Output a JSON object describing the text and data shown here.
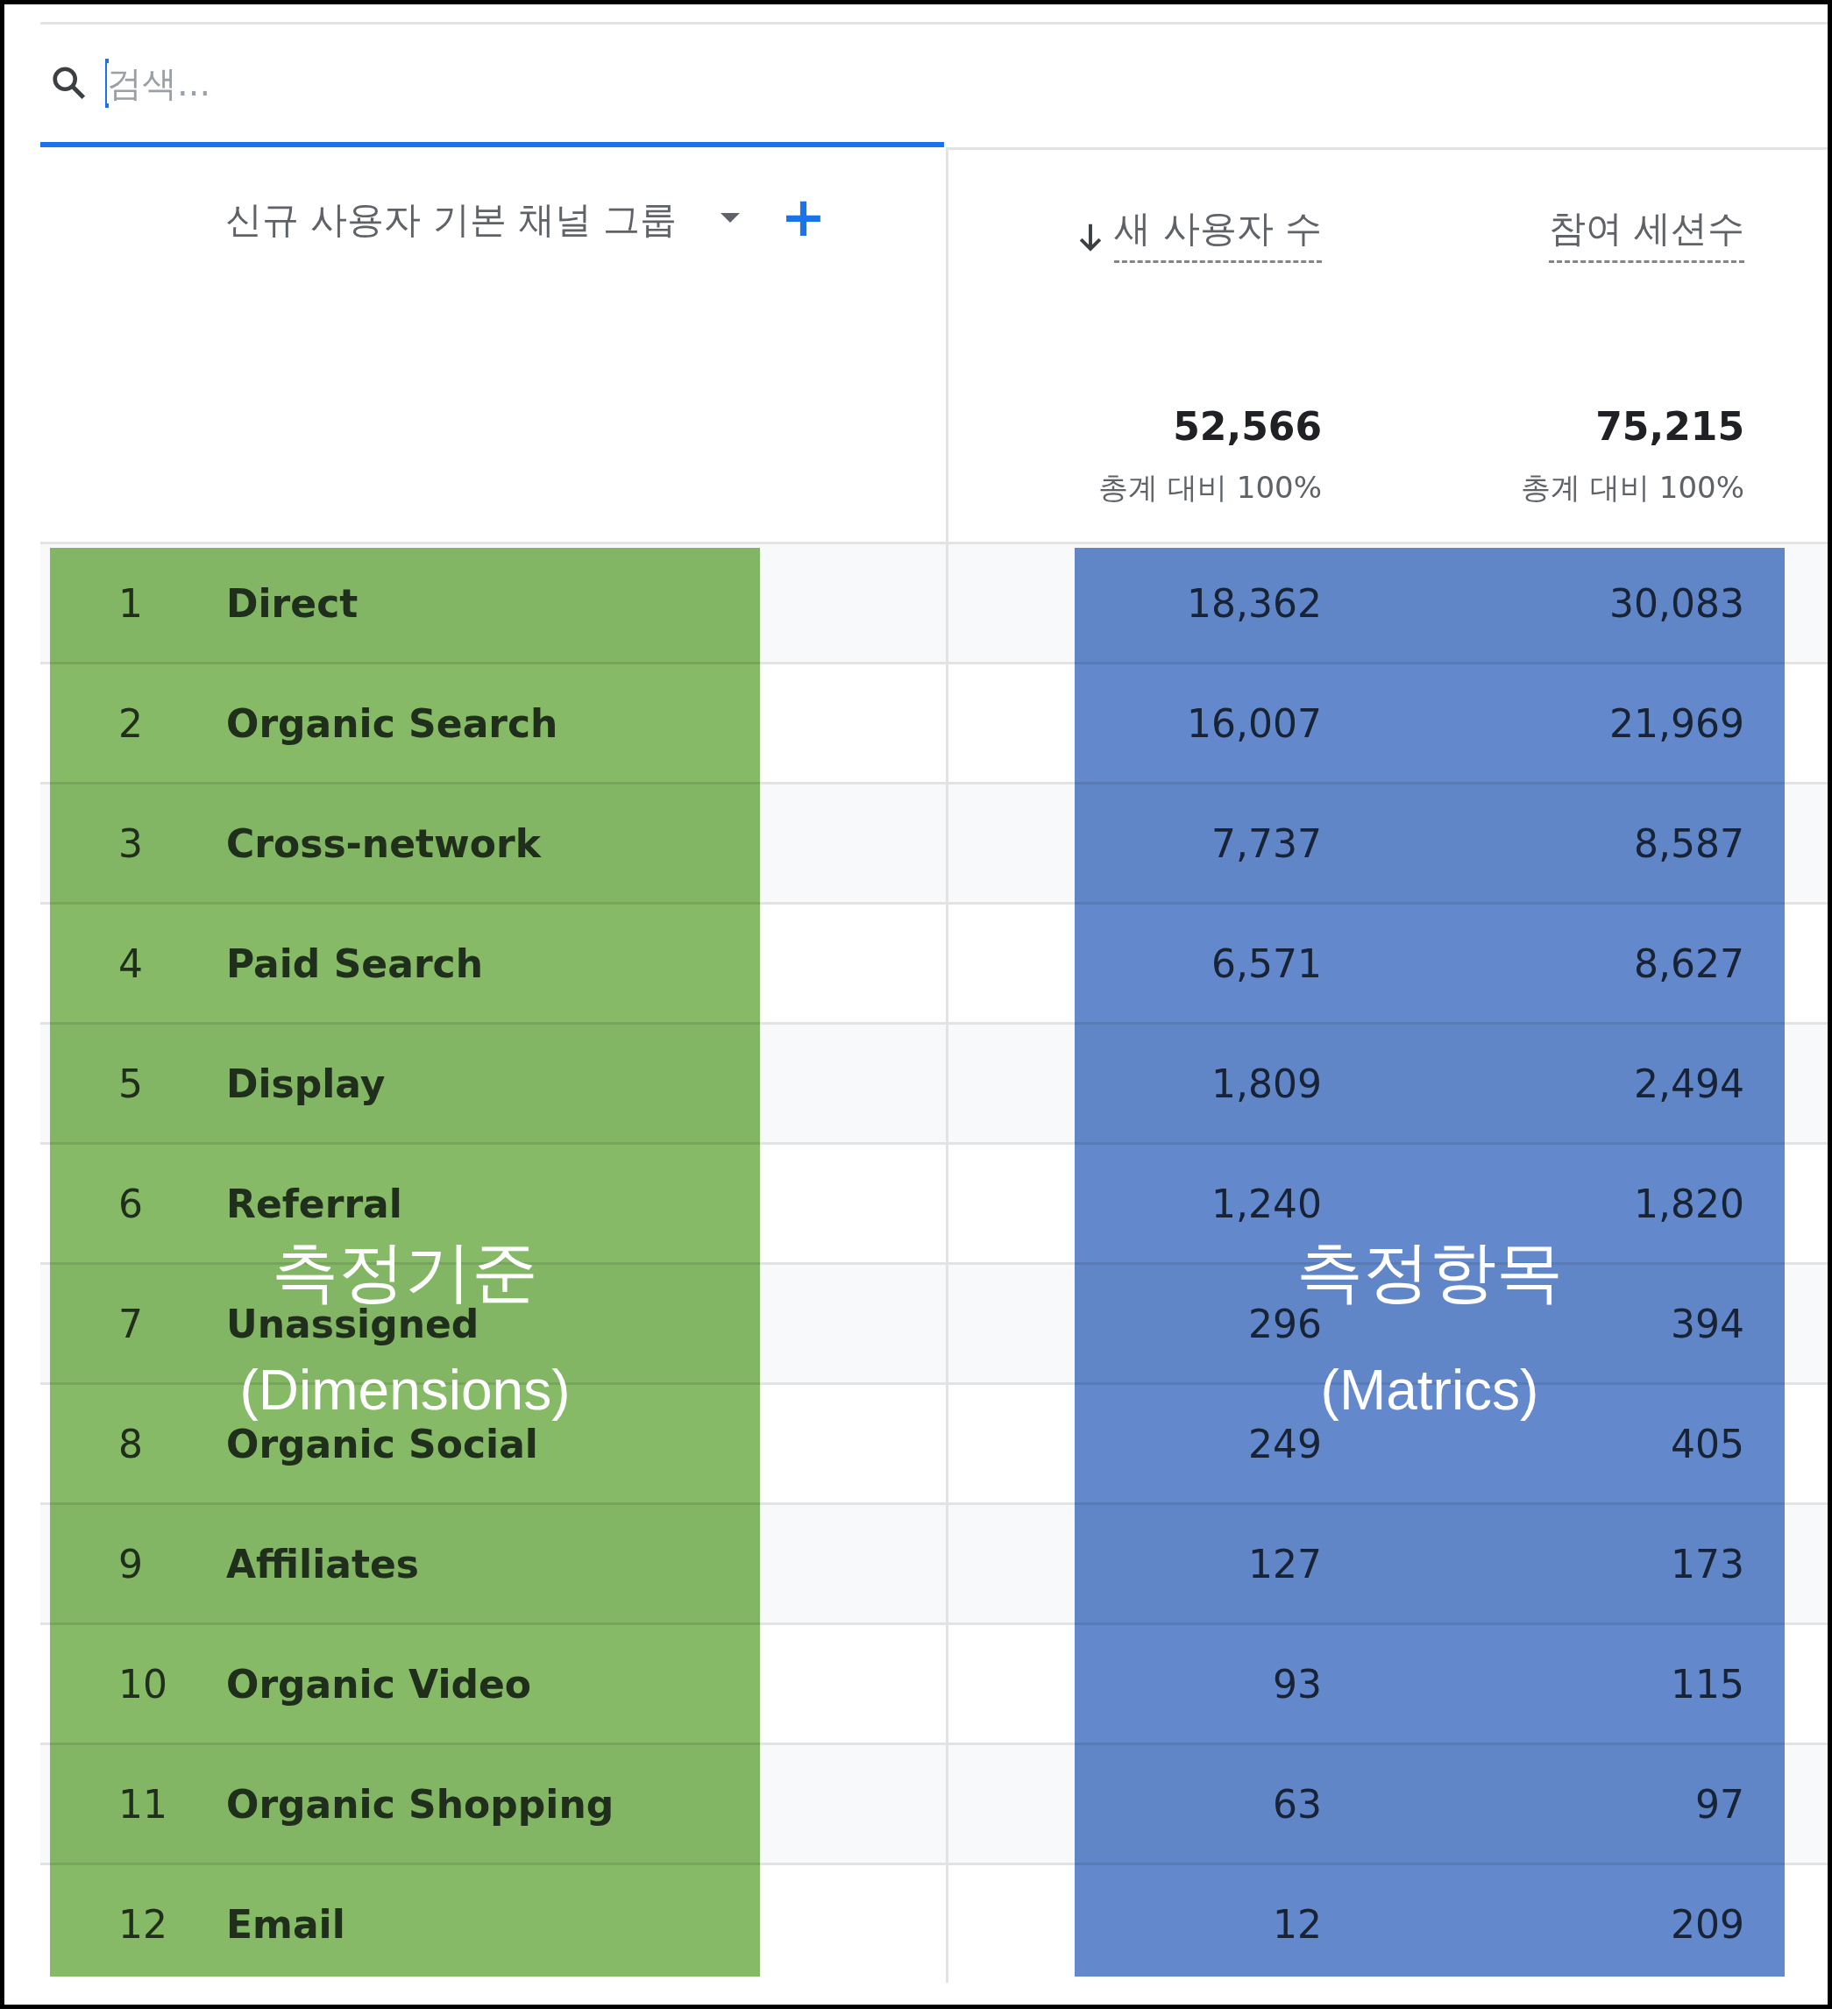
{
  "search": {
    "placeholder": "검색..."
  },
  "dimension_header": {
    "label": "신규 사용자 기본 채널 그룹",
    "has_dropdown": true,
    "add_button": "+"
  },
  "metric_columns": [
    {
      "label": "새 사용자 수",
      "sorted": true,
      "total": "52,566",
      "total_share": "총계 대비 100%"
    },
    {
      "label": "참여 세션수",
      "sorted": false,
      "total": "75,215",
      "total_share": "총계 대비 100%"
    }
  ],
  "rows": [
    {
      "rank": "1",
      "name": "Direct",
      "values": [
        "18,362",
        "30,083"
      ]
    },
    {
      "rank": "2",
      "name": "Organic Search",
      "values": [
        "16,007",
        "21,969"
      ]
    },
    {
      "rank": "3",
      "name": "Cross-network",
      "values": [
        "7,737",
        "8,587"
      ]
    },
    {
      "rank": "4",
      "name": "Paid Search",
      "values": [
        "6,571",
        "8,627"
      ]
    },
    {
      "rank": "5",
      "name": "Display",
      "values": [
        "1,809",
        "2,494"
      ]
    },
    {
      "rank": "6",
      "name": "Referral",
      "values": [
        "1,240",
        "1,820"
      ]
    },
    {
      "rank": "7",
      "name": "Unassigned",
      "values": [
        "296",
        "394"
      ]
    },
    {
      "rank": "8",
      "name": "Organic Social",
      "values": [
        "249",
        "405"
      ]
    },
    {
      "rank": "9",
      "name": "Affiliates",
      "values": [
        "127",
        "173"
      ]
    },
    {
      "rank": "10",
      "name": "Organic Video",
      "values": [
        "93",
        "115"
      ]
    },
    {
      "rank": "11",
      "name": "Organic Shopping",
      "values": [
        "63",
        "97"
      ]
    },
    {
      "rank": "12",
      "name": "Email",
      "values": [
        "12",
        "209"
      ]
    }
  ],
  "annotations": [
    {
      "kind": "dimensions",
      "title": "측정기준",
      "subtitle": "(Dimensions)"
    },
    {
      "kind": "metrics",
      "title": "측정항목",
      "subtitle": "(Matrics)"
    }
  ]
}
